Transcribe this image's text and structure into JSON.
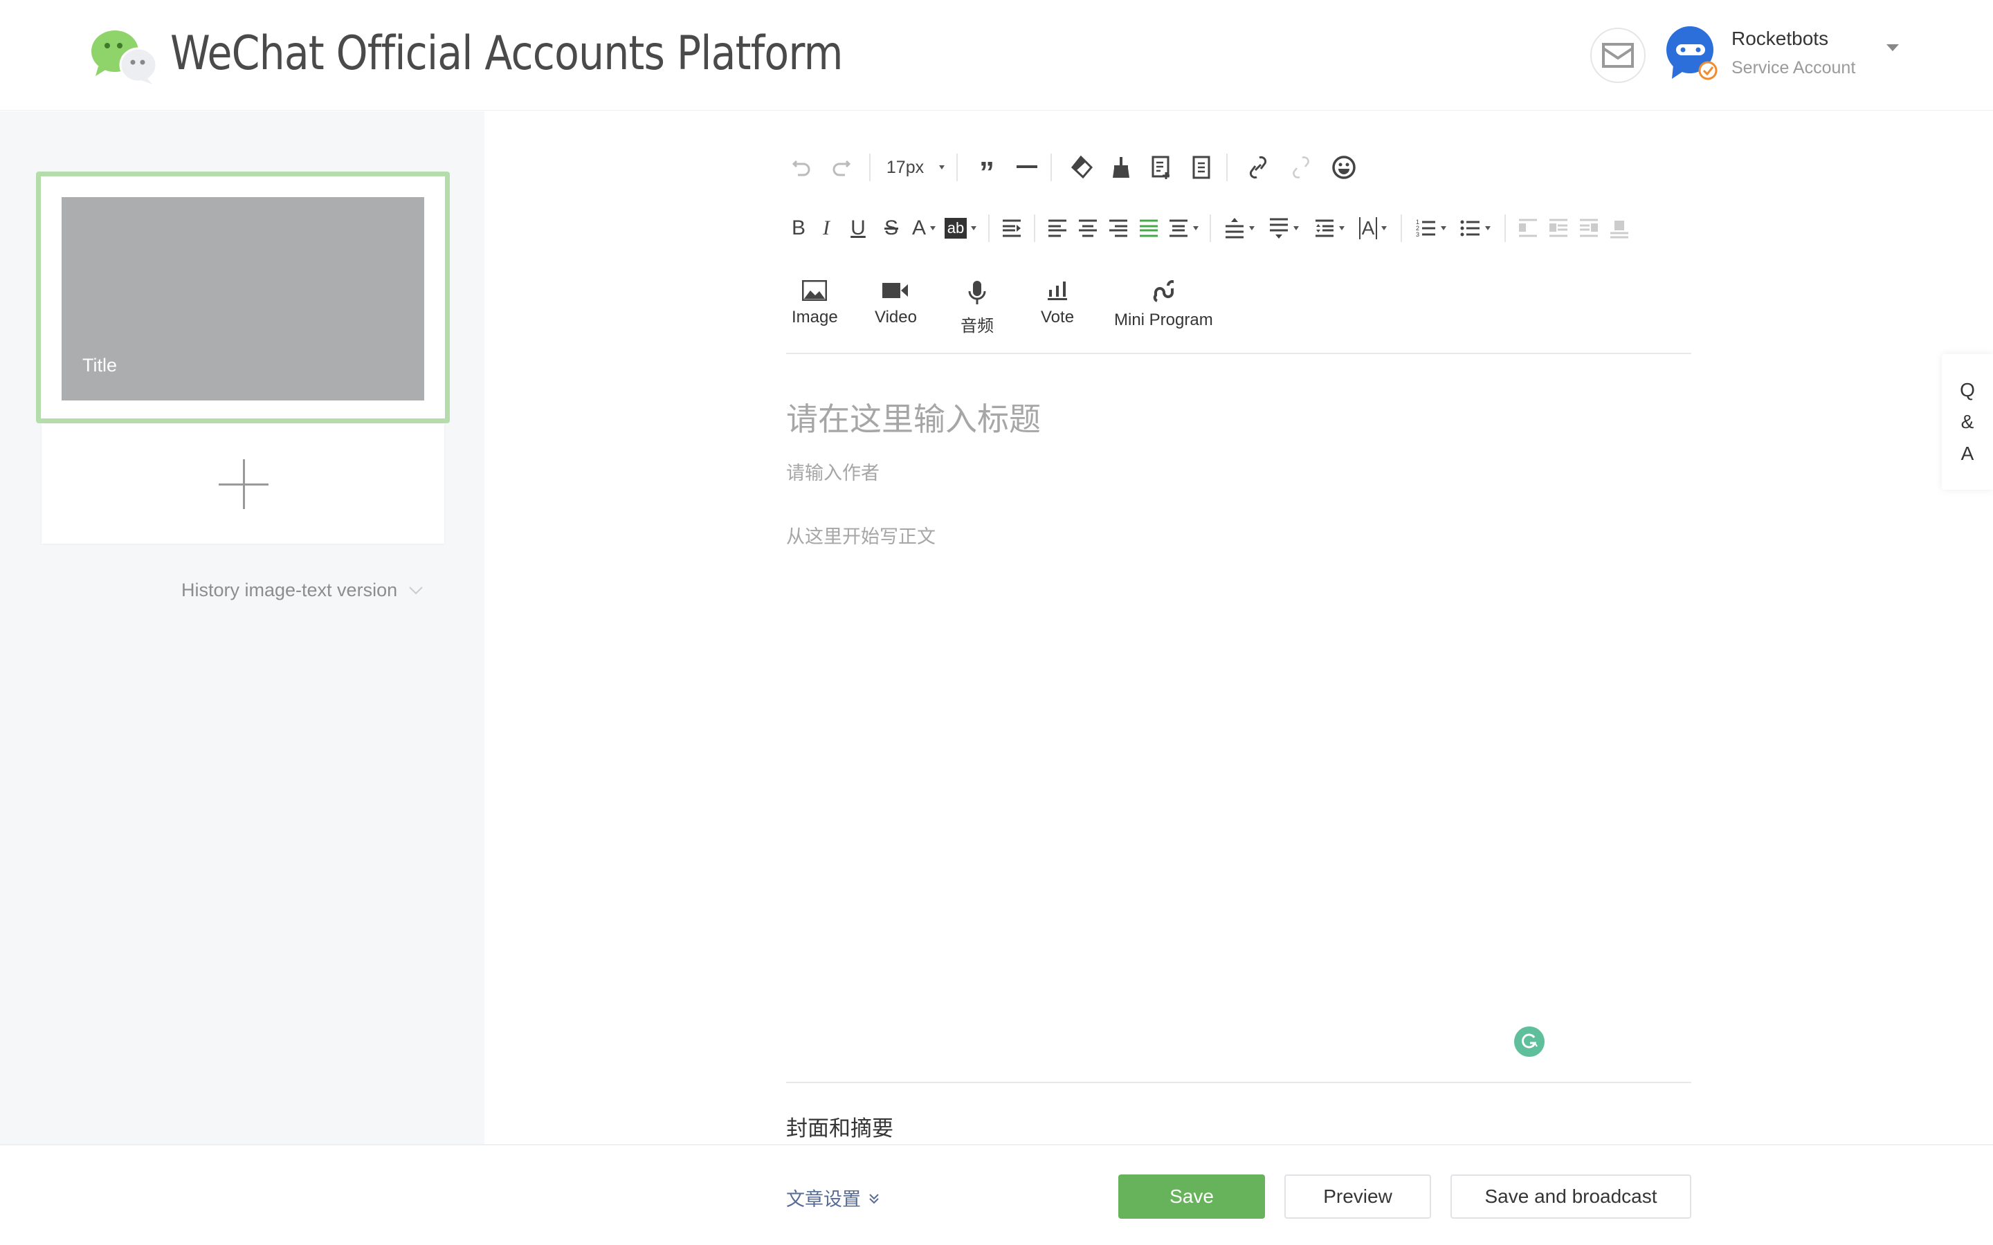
{
  "header": {
    "brand": "WeChat Official Accounts Platform",
    "account": {
      "name": "Rocketbots",
      "type": "Service Account"
    },
    "icons": {
      "logo": "wechat-logo-icon",
      "mail": "mail-icon",
      "avatar": "robot-avatar-icon",
      "verified": "verified-check-icon",
      "caret": "caret-down-icon"
    }
  },
  "left_panel": {
    "article_card": {
      "title": "Title"
    },
    "add_label": "add-article",
    "history_link": "History image-text version"
  },
  "toolbar": {
    "font_size": "17px",
    "row1": [
      "undo",
      "redo",
      "font-size",
      "blockquote",
      "horizontal-rule",
      "clear-format",
      "format-brush",
      "insert-template",
      "template",
      "link",
      "unlink",
      "emoji"
    ],
    "row2": [
      "bold",
      "italic",
      "underline",
      "strikethrough",
      "font-color",
      "background-color",
      "indent",
      "align-left",
      "align-center",
      "align-right",
      "justify",
      "align-distribute",
      "space-before",
      "space-after",
      "line-height",
      "letter-spacing",
      "ordered-list",
      "unordered-list",
      "image-float-left",
      "image-float-block-left",
      "image-float-right",
      "image-float-center"
    ],
    "active_color": "#44a94a"
  },
  "insert_bar": [
    {
      "label": "Image",
      "icon": "image-icon"
    },
    {
      "label": "Video",
      "icon": "video-icon"
    },
    {
      "label": "音频",
      "icon": "microphone-icon"
    },
    {
      "label": "Vote",
      "icon": "vote-icon"
    },
    {
      "label": "Mini Program",
      "icon": "mini-program-icon"
    }
  ],
  "editor": {
    "title_placeholder": "请在这里输入标题",
    "author_placeholder": "请输入作者",
    "body_placeholder": "从这里开始写正文",
    "cover_section": "封面和摘要"
  },
  "footer": {
    "settings_link": "文章设置",
    "save": "Save",
    "preview": "Preview",
    "save_broadcast": "Save and broadcast"
  },
  "qa": [
    "Q",
    "&",
    "A"
  ],
  "colors": {
    "primary": "#67b35b",
    "selected_border": "#b5dcab",
    "link": "#576b95",
    "grammarly": "#5fbf9b"
  }
}
